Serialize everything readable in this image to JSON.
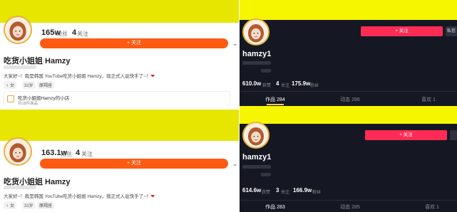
{
  "kuaishou": {
    "top": {
      "followers": "165w",
      "followers_label": "粉丝",
      "following": "4",
      "following_label": "关注",
      "follow_button": "+ 关注",
      "name": "吃货小姐姐 Hamzy",
      "bio": "大家好~！我是韩国 YouTube吃货小姐姐 Hamzy，现正式入驻快手了~！",
      "gender_tag": "♀ 女",
      "age_tag": "31岁",
      "location_tag": "摩羯座",
      "shop_title": "吃货小姐姐Hamzy的小店",
      "shop_sub": "共18件商品"
    },
    "bottom": {
      "followers": "163.1w",
      "followers_label": "粉丝",
      "following": "4",
      "following_label": "关注",
      "follow_button": "+ 关注",
      "name": "吃货小姐姐 Hamzy",
      "bio": "大家好~！我是韩国 YouTube吃货小姐姐 Hamzy，我正式入驻快手了~！",
      "gender_tag": "♀ 女",
      "age_tag": "31岁",
      "location_tag": "摩羯座"
    }
  },
  "tiktok": {
    "top": {
      "name": "hamzy1",
      "follow_button": "+ 关注",
      "message_button": "私信",
      "likes": "610.0w",
      "likes_label": "获赞",
      "following": "4",
      "following_label": "关注",
      "fans": "175.9w",
      "fans_label": "粉丝",
      "tab_works": "作品 284",
      "tab_dynamic": "动态 286",
      "tab_likes": "喜欢 1"
    },
    "bottom": {
      "name": "hamzy1",
      "follow_button": "+ 关注",
      "likes": "614.6w",
      "likes_label": "获赞",
      "following": "3",
      "following_label": "关注",
      "fans": "166.9w",
      "fans_label": "粉丝",
      "tab_works": "作品 283",
      "tab_dynamic": "动态 285",
      "tab_likes": "喜欢 1"
    }
  },
  "colors": {
    "yellow_banner": "#e6e600",
    "kuaishou_orange": "#ff5a12",
    "tiktok_red": "#fe2c55",
    "tiktok_bg": "#151823",
    "heart": "#e02020"
  }
}
